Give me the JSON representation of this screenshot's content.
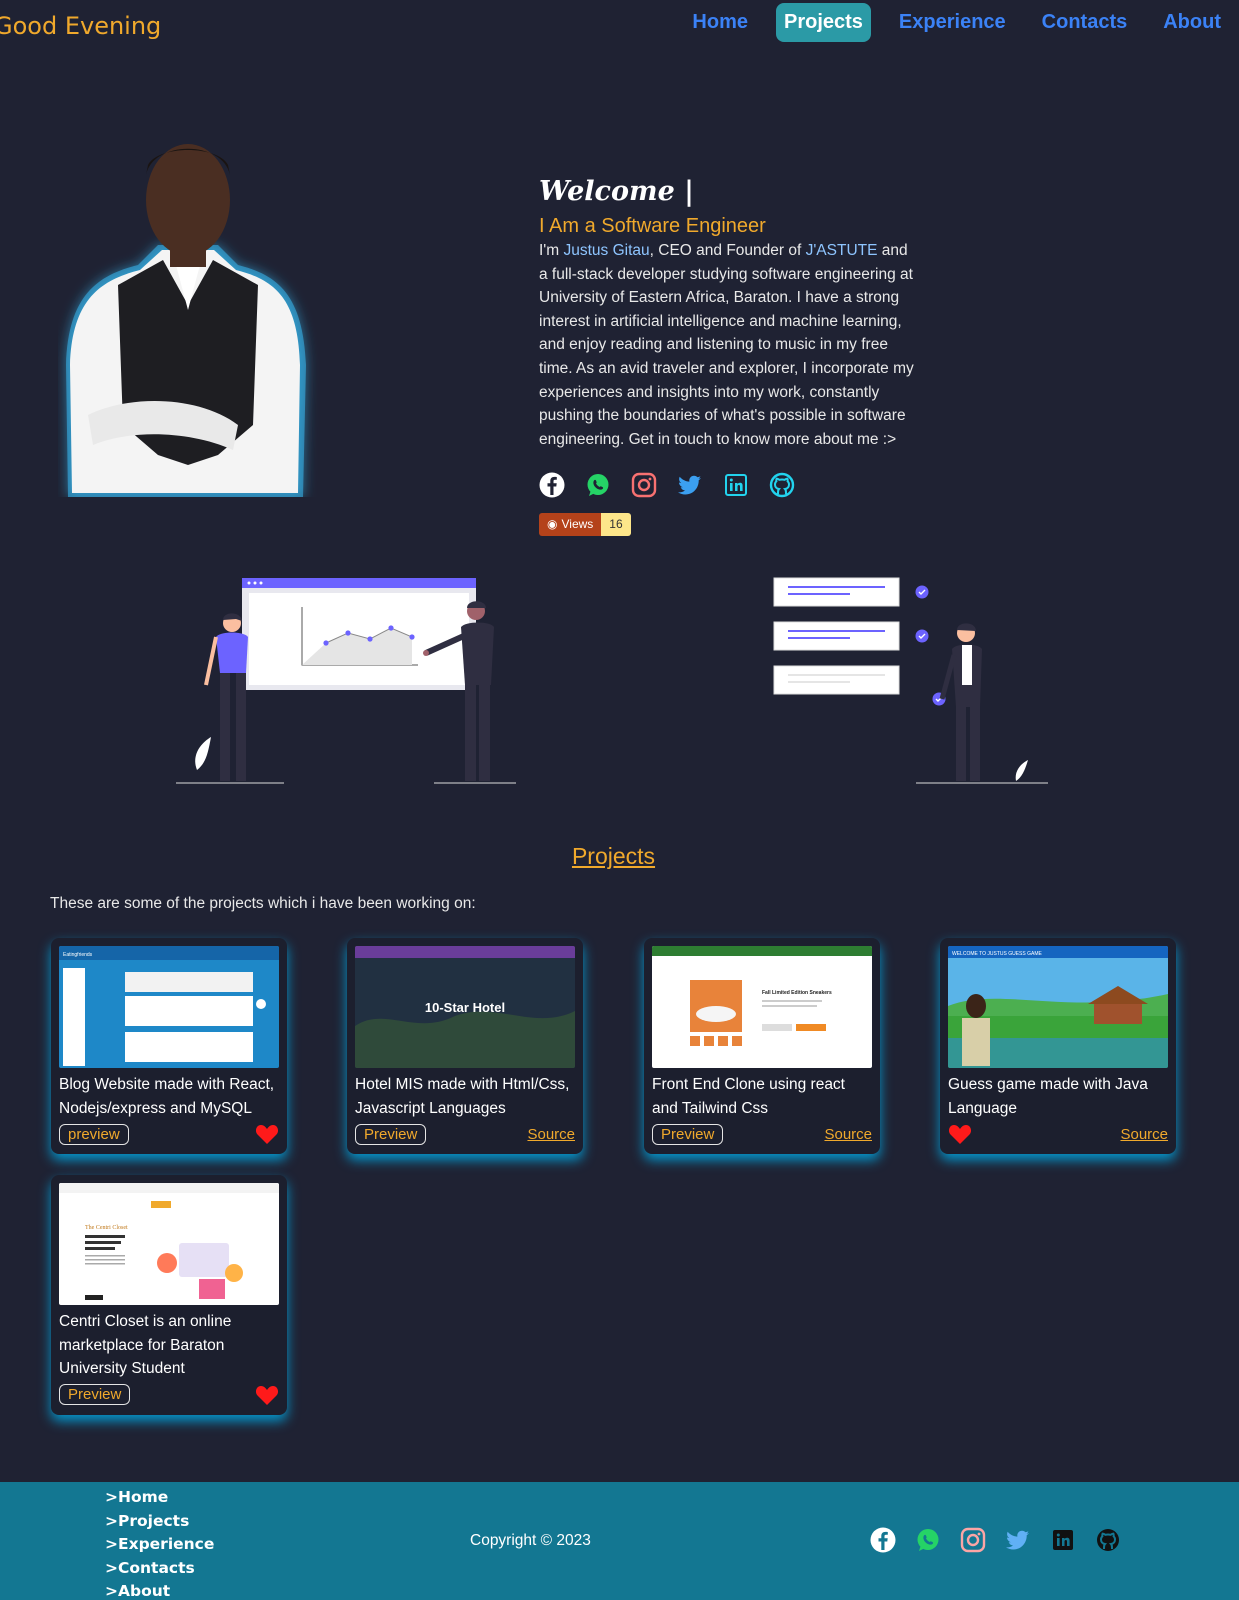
{
  "nav": {
    "greeting": "Good Evening",
    "links": [
      "Home",
      "Projects",
      "Experience",
      "Contacts",
      "About"
    ],
    "active": "Projects"
  },
  "hero": {
    "welcome": "Welcome |",
    "role": "I Am a Software Engineer",
    "bio_prefix": "I'm ",
    "bio_name": "Justus Gitau",
    "bio_mid": ", CEO and Founder of ",
    "bio_company": "J'ASTUTE",
    "bio_rest": " and a full-stack developer studying software engineering at University of Eastern Africa, Baraton. I have a strong interest in artificial intelligence and machine learning, and enjoy reading and listening to music in my free time. As an avid traveler and explorer, I incorporate my experiences and insights into my work, constantly pushing the boundaries of what's possible in software engineering. Get in touch to know more about me :>",
    "socials": [
      "facebook-icon",
      "whatsapp-icon",
      "instagram-icon",
      "twitter-icon",
      "linkedin-icon",
      "github-icon"
    ],
    "views_label": "Views",
    "views_count": "16"
  },
  "projects": {
    "title": "Projects",
    "intro": "These are some of the projects which i have been working on:",
    "items": [
      {
        "title": "Blog Website made with React, Nodejs/express and MySQL",
        "preview": "preview",
        "source": "",
        "liked": true,
        "shot_text": "Eatingfriends"
      },
      {
        "title": "Hotel MIS made with Html/Css, Javascript Languages",
        "preview": "Preview",
        "source": "Source",
        "liked": false,
        "shot_text": "10-Star Hotel"
      },
      {
        "title": "Front End Clone using react and Tailwind Css",
        "preview": "Preview",
        "source": "Source",
        "liked": false,
        "shot_text": "Fall Limited Edition Sneakers"
      },
      {
        "title": "Guess game made with Java Language",
        "preview": "",
        "source": "Source",
        "liked": true,
        "shot_text": "WELCOME TO JUSTUS GUESS GAME"
      },
      {
        "title": "Centri Closet is an online marketplace for Baraton University Student",
        "preview": "Preview",
        "source": "",
        "liked": true,
        "shot_text": "The Centri Closet"
      }
    ]
  },
  "footer": {
    "links": [
      ">Home",
      ">Projects",
      ">Experience",
      ">Contacts",
      ">About"
    ],
    "copyright": "Copyright © 2023"
  },
  "colors": {
    "background": "#1f2233",
    "accent_orange": "#f0a92c",
    "nav_blue": "#3b82f6",
    "active_tab": "#2b9aa6",
    "footer": "#137792",
    "card_glow": "#00aae6"
  }
}
